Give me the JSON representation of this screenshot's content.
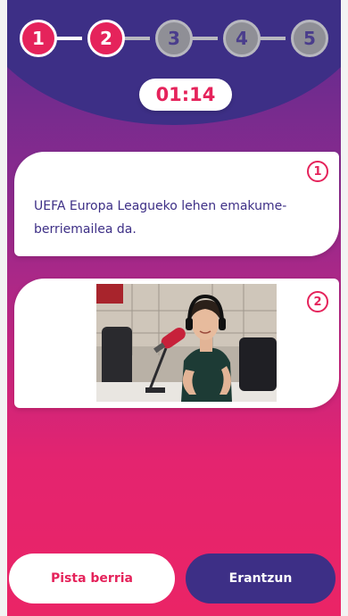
{
  "steps": [
    {
      "label": "1",
      "state": "active"
    },
    {
      "label": "2",
      "state": "active"
    },
    {
      "label": "3",
      "state": "inactive"
    },
    {
      "label": "4",
      "state": "inactive"
    },
    {
      "label": "5",
      "state": "inactive"
    }
  ],
  "timer": "01:14",
  "clues": [
    {
      "number": "1",
      "text": "UEFA Europa Leagueko lehen emakume-berriemailea da."
    },
    {
      "number": "2",
      "image": "woman-at-radio-microphone"
    }
  ],
  "buttons": {
    "hint_label": "Pista berria",
    "answer_label": "Erantzun"
  },
  "colors": {
    "accent": "#e5235b",
    "dark_purple": "#3d2f86",
    "inactive_step": "#8f8f96"
  }
}
